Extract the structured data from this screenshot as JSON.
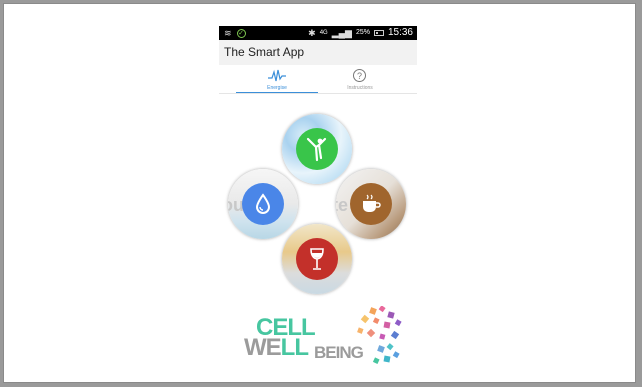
{
  "status_bar": {
    "battery": "25%",
    "time": "15:36",
    "network": "4G"
  },
  "app": {
    "title": "The Smart App"
  },
  "tabs": [
    {
      "label": "Energise",
      "icon": "pulse-icon",
      "active": true
    },
    {
      "label": "Instructions",
      "icon": "question-icon",
      "active": false
    }
  ],
  "categories": [
    {
      "name": "fitness",
      "icon": "yoga-pose-icon",
      "color": "#39c54a"
    },
    {
      "name": "water",
      "icon": "water-drop-icon",
      "color": "#4a86e8"
    },
    {
      "name": "coffee",
      "icon": "coffee-cup-icon",
      "color": "#a0652d"
    },
    {
      "name": "wine",
      "icon": "wine-glass-icon",
      "color": "#c3302a"
    }
  ],
  "logo": {
    "line1": "CELL",
    "line2_part1": "WE",
    "line2_part2": "LL",
    "line2_part3": "BEING"
  },
  "colors": {
    "accent": "#3b8fd9",
    "background": "#ffffff"
  }
}
